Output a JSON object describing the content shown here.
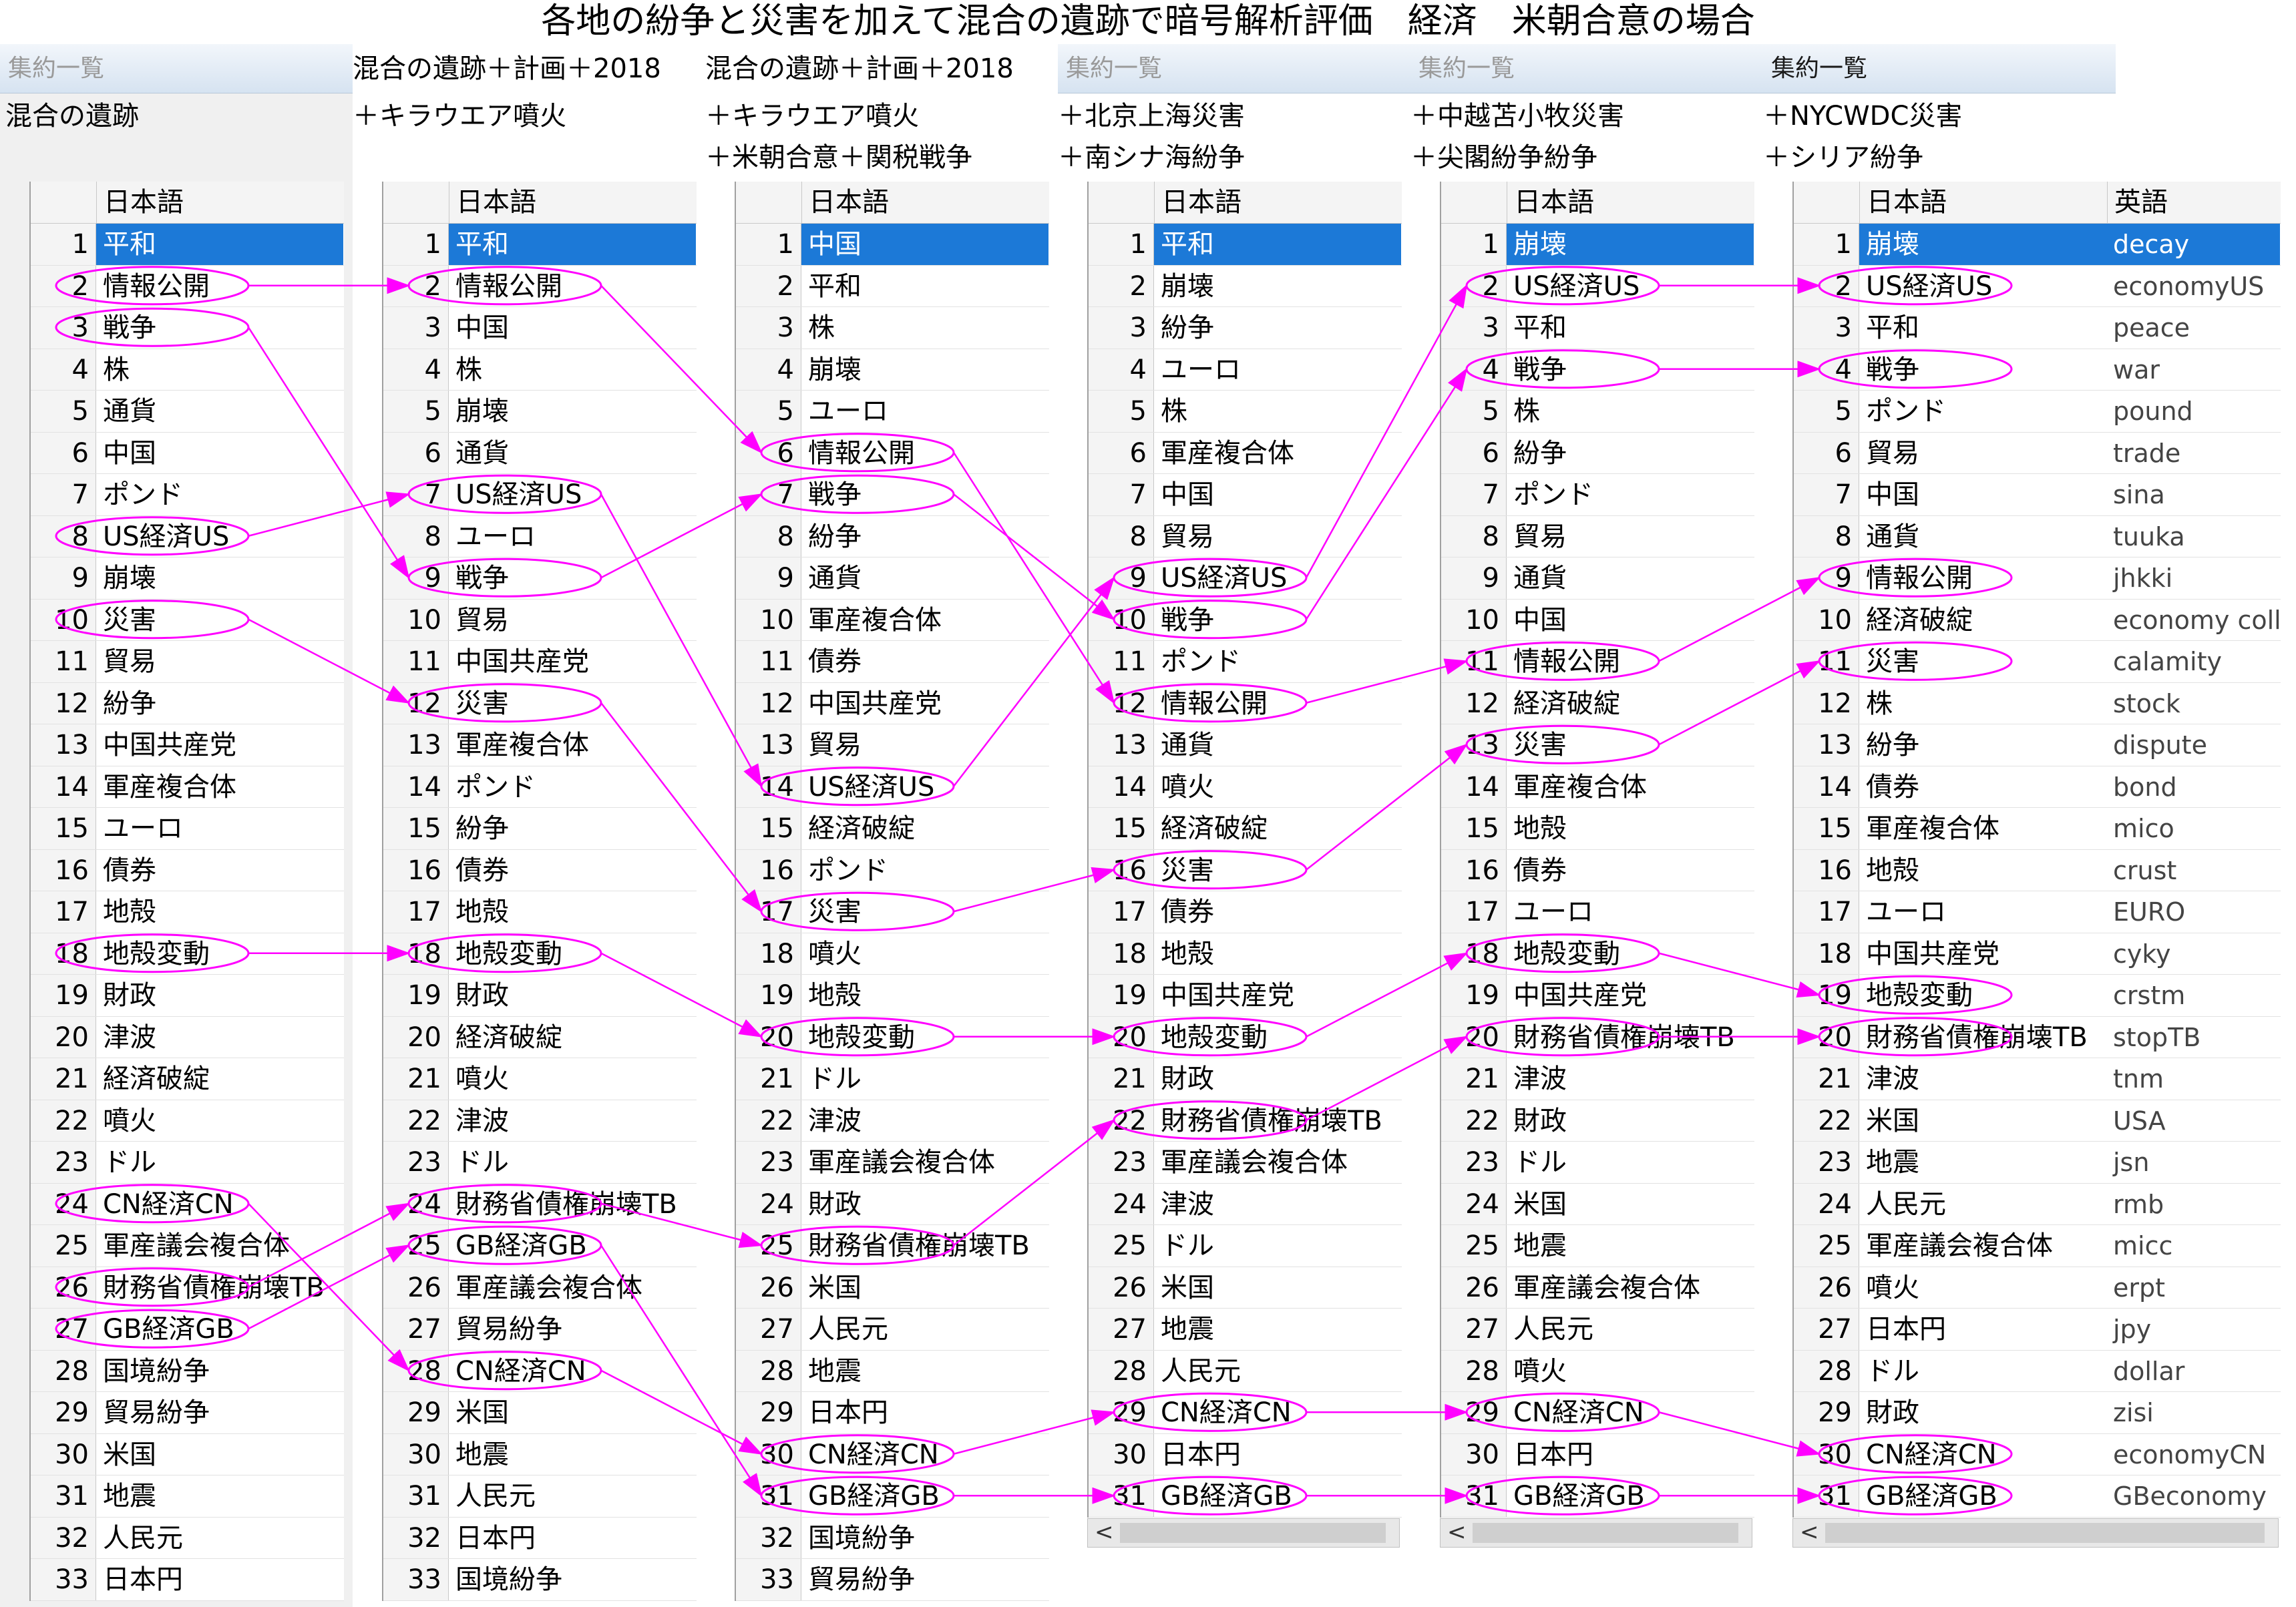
{
  "title": "各地の紛争と災害を加えて混合の遺跡で暗号解析評価　経済　米朝合意の場合",
  "panels": [
    {
      "header": "集約一覧",
      "header_active": false,
      "lines": [
        "混合の遺跡"
      ],
      "col_ja": "日本語",
      "rows": [
        "平和",
        "情報公開",
        "戦争",
        "株",
        "通貨",
        "中国",
        "ポンド",
        "US経済US",
        "崩壊",
        "災害",
        "貿易",
        "紛争",
        "中国共産党",
        "軍産複合体",
        "ユーロ",
        "債券",
        "地殻",
        "地殻変動",
        "財政",
        "津波",
        "経済破綻",
        "噴火",
        "ドル",
        "CN経済CN",
        "軍産議会複合体",
        "財務省債権崩壊TB",
        "GB経済GB",
        "国境紛争",
        "貿易紛争",
        "米国",
        "地震",
        "人民元",
        "日本円"
      ]
    },
    {
      "header": "混合の遺跡＋計画＋2018",
      "header_active": true,
      "lines": [
        "＋キラウエア噴火"
      ],
      "col_ja": "日本語",
      "rows": [
        "平和",
        "情報公開",
        "中国",
        "株",
        "崩壊",
        "通貨",
        "US経済US",
        "ユーロ",
        "戦争",
        "貿易",
        "中国共産党",
        "災害",
        "軍産複合体",
        "ポンド",
        "紛争",
        "債券",
        "地殻",
        "地殻変動",
        "財政",
        "経済破綻",
        "噴火",
        "津波",
        "ドル",
        "財務省債権崩壊TB",
        "GB経済GB",
        "軍産議会複合体",
        "貿易紛争",
        "CN経済CN",
        "米国",
        "地震",
        "人民元",
        "日本円",
        "国境紛争"
      ]
    },
    {
      "header": "混合の遺跡＋計画＋2018",
      "header_active": true,
      "lines": [
        "＋キラウエア噴火",
        "＋米朝合意＋関税戦争"
      ],
      "col_ja": "日本語",
      "rows": [
        "中国",
        "平和",
        "株",
        "崩壊",
        "ユーロ",
        "情報公開",
        "戦争",
        "紛争",
        "通貨",
        "軍産複合体",
        "債券",
        "中国共産党",
        "貿易",
        "US経済US",
        "経済破綻",
        "ポンド",
        "災害",
        "噴火",
        "地殻",
        "地殻変動",
        "ドル",
        "津波",
        "軍産議会複合体",
        "財政",
        "財務省債権崩壊TB",
        "米国",
        "人民元",
        "地震",
        "日本円",
        "CN経済CN",
        "GB経済GB",
        "国境紛争",
        "貿易紛争"
      ]
    },
    {
      "header": "集約一覧",
      "header_active": false,
      "lines": [
        "＋北京上海災害",
        "＋南シナ海紛争"
      ],
      "col_ja": "日本語",
      "rows": [
        "平和",
        "崩壊",
        "紛争",
        "ユーロ",
        "株",
        "軍産複合体",
        "中国",
        "貿易",
        "US経済US",
        "戦争",
        "ポンド",
        "情報公開",
        "通貨",
        "噴火",
        "経済破綻",
        "災害",
        "債券",
        "地殻",
        "中国共産党",
        "地殻変動",
        "財政",
        "財務省債権崩壊TB",
        "軍産議会複合体",
        "津波",
        "ドル",
        "米国",
        "地震",
        "人民元",
        "CN経済CN",
        "日本円",
        "GB経済GB"
      ],
      "scroll_arrow": "<"
    },
    {
      "header": "集約一覧",
      "header_active": false,
      "lines": [
        "＋中越苫小牧災害",
        "＋尖閣紛争紛争"
      ],
      "col_ja": "日本語",
      "rows": [
        "崩壊",
        "US経済US",
        "平和",
        "戦争",
        "株",
        "紛争",
        "ポンド",
        "貿易",
        "通貨",
        "中国",
        "情報公開",
        "経済破綻",
        "災害",
        "軍産複合体",
        "地殻",
        "債券",
        "ユーロ",
        "地殻変動",
        "中国共産党",
        "財務省債権崩壊TB",
        "津波",
        "財政",
        "ドル",
        "米国",
        "地震",
        "軍産議会複合体",
        "人民元",
        "噴火",
        "CN経済CN",
        "日本円",
        "GB経済GB"
      ],
      "scroll_arrow": "<"
    },
    {
      "header": "集約一覧",
      "header_active": true,
      "lines": [
        "＋NYCWDC災害",
        "＋シリア紛争"
      ],
      "col_ja": "日本語",
      "col_en": "英語",
      "rows": [
        "崩壊",
        "US経済US",
        "平和",
        "戦争",
        "ポンド",
        "貿易",
        "中国",
        "通貨",
        "情報公開",
        "経済破綻",
        "災害",
        "株",
        "紛争",
        "債券",
        "軍産複合体",
        "地殻",
        "ユーロ",
        "中国共産党",
        "地殻変動",
        "財務省債権崩壊TB",
        "津波",
        "米国",
        "地震",
        "人民元",
        "軍産議会複合体",
        "噴火",
        "日本円",
        "ドル",
        "財政",
        "CN経済CN",
        "GB経済GB"
      ],
      "en": [
        "decay",
        "economyUS",
        "peace",
        "war",
        "pound",
        "trade",
        "sina",
        "tuuka",
        "jhkki",
        "economy colla",
        "calamity",
        "stock",
        "dispute",
        "bond",
        "mico",
        "crust",
        "EURO",
        "cyky",
        "crstm",
        "stopTB",
        "tnm",
        "USA",
        "jsn",
        "rmb",
        "micc",
        "erpt",
        "jpy",
        "dollar",
        "zisi",
        "economyCN",
        "GBeconomy"
      ],
      "scroll_arrow": "<"
    }
  ],
  "annotations": {
    "color": "#ff00ff",
    "circled": [
      [
        2,
        3,
        8,
        10,
        18,
        24,
        26,
        27
      ],
      [
        2,
        7,
        9,
        12,
        18,
        24,
        25,
        28
      ],
      [
        6,
        7,
        14,
        17,
        20,
        25,
        30,
        31
      ],
      [
        9,
        10,
        12,
        16,
        20,
        22,
        29,
        31
      ],
      [
        2,
        4,
        11,
        13,
        18,
        20,
        29,
        31
      ],
      [
        2,
        4,
        9,
        11,
        19,
        20,
        30,
        31
      ]
    ],
    "links": [
      [
        [
          2,
          2
        ],
        [
          3,
          9
        ],
        [
          8,
          7
        ],
        [
          10,
          12
        ],
        [
          18,
          18
        ],
        [
          24,
          28
        ],
        [
          26,
          24
        ],
        [
          27,
          25
        ]
      ],
      [
        [
          2,
          6
        ],
        [
          7,
          14
        ],
        [
          9,
          7
        ],
        [
          12,
          17
        ],
        [
          18,
          20
        ],
        [
          24,
          25
        ],
        [
          25,
          31
        ],
        [
          28,
          30
        ]
      ],
      [
        [
          6,
          12
        ],
        [
          7,
          10
        ],
        [
          14,
          9
        ],
        [
          17,
          16
        ],
        [
          20,
          20
        ],
        [
          25,
          22
        ],
        [
          30,
          29
        ],
        [
          31,
          31
        ]
      ],
      [
        [
          9,
          2
        ],
        [
          10,
          4
        ],
        [
          12,
          11
        ],
        [
          16,
          13
        ],
        [
          20,
          18
        ],
        [
          22,
          20
        ],
        [
          29,
          29
        ],
        [
          31,
          31
        ]
      ],
      [
        [
          2,
          2
        ],
        [
          4,
          4
        ],
        [
          11,
          9
        ],
        [
          13,
          11
        ],
        [
          18,
          19
        ],
        [
          20,
          20
        ],
        [
          29,
          30
        ],
        [
          31,
          31
        ]
      ]
    ]
  }
}
